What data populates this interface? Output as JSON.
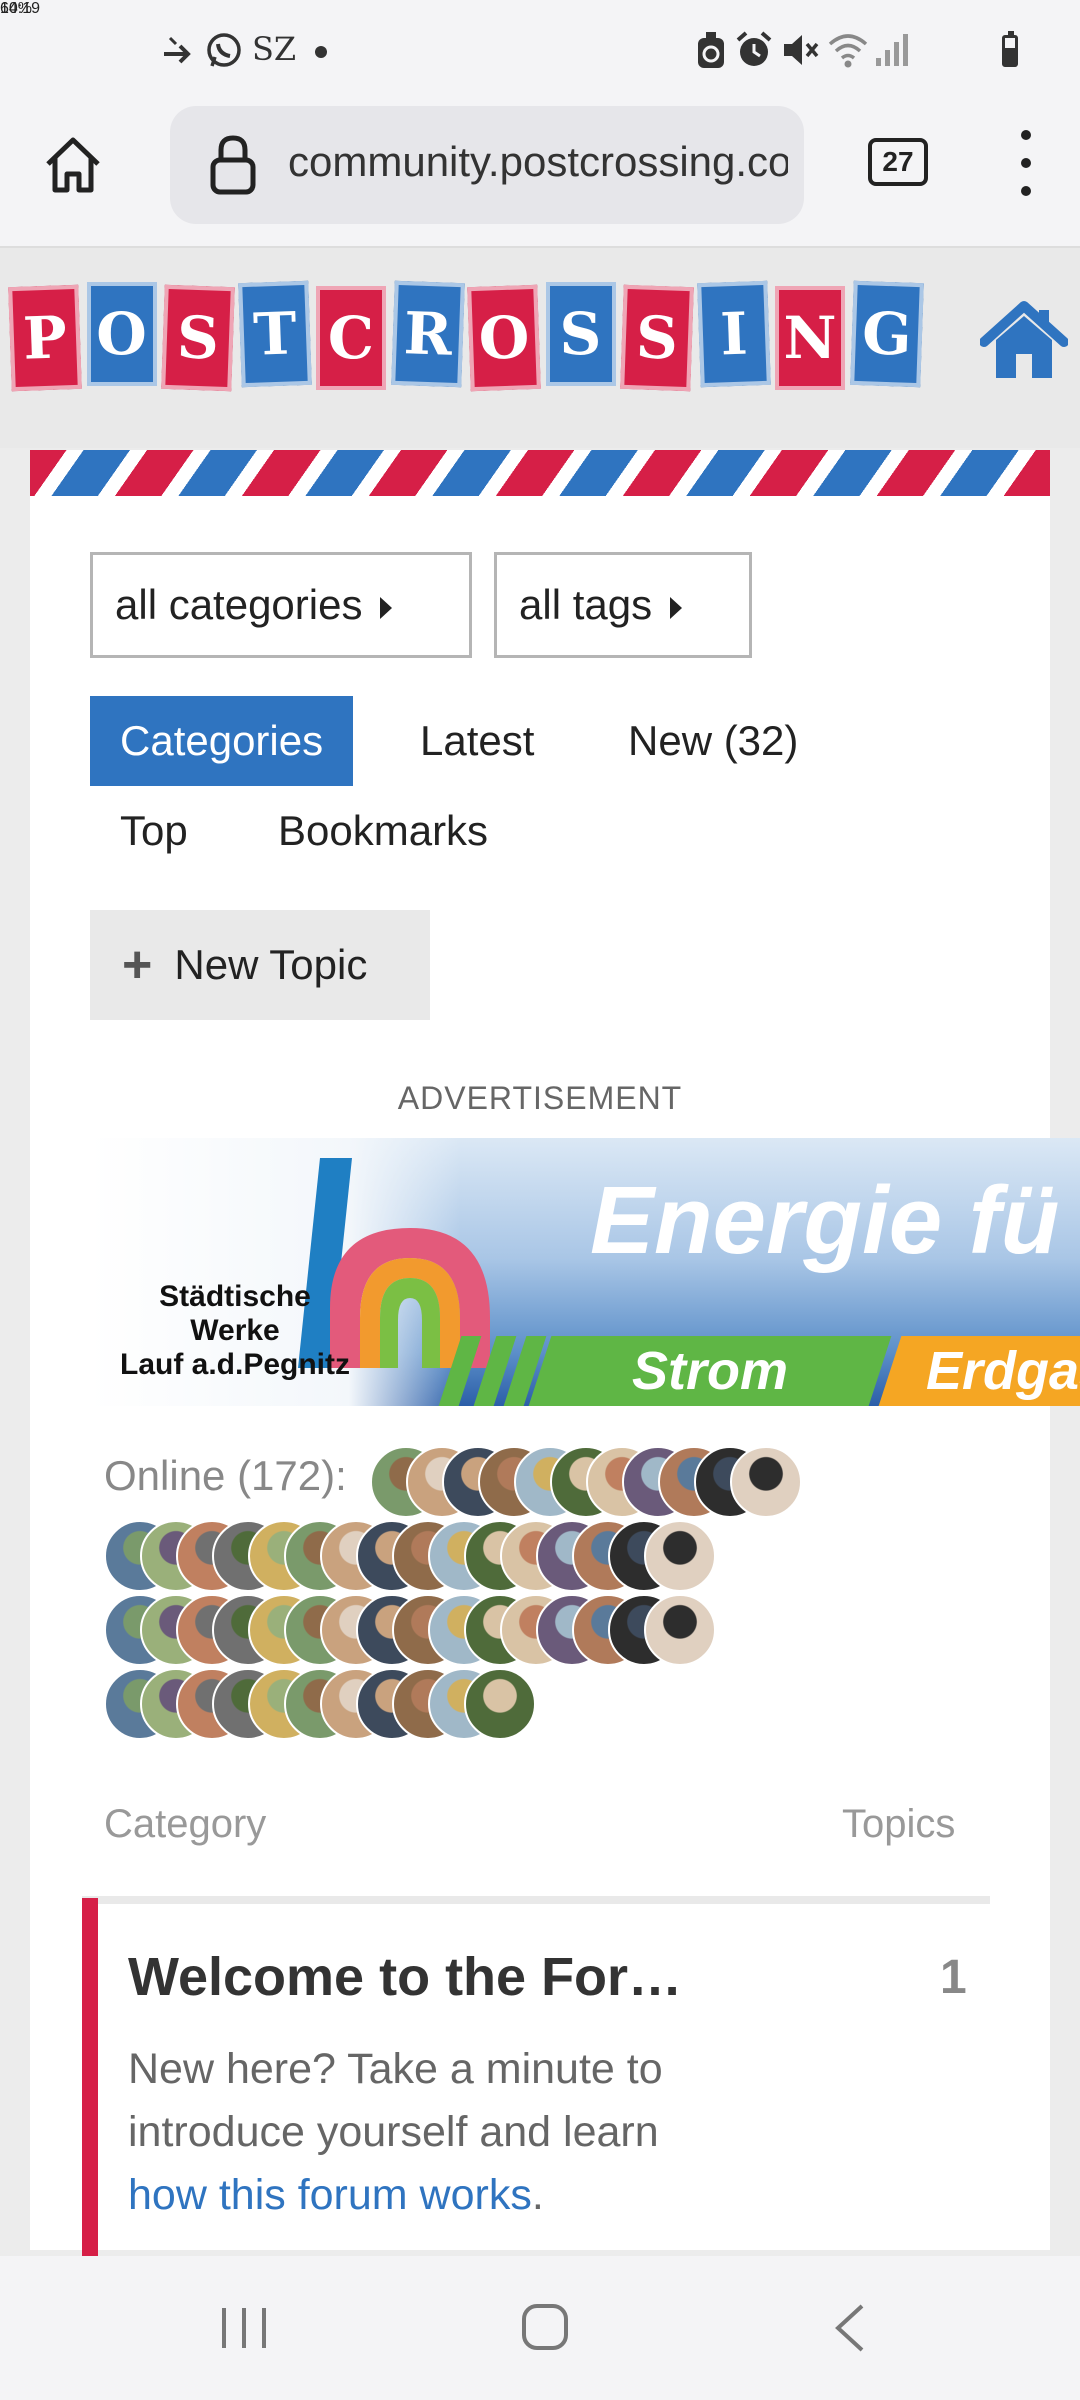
{
  "status_bar": {
    "time": "14:19",
    "left_icons": [
      "call-forward-icon",
      "whatsapp-icon",
      "sz-icon",
      "dot-icon"
    ],
    "sz_text": "SZ",
    "right_icons": [
      "recycle-icon",
      "alarm-icon",
      "mute-icon",
      "wifi-icon",
      "signal-icon"
    ],
    "battery": "60%",
    "battery_level": 0.6
  },
  "browser": {
    "url": "community.postcrossing.com",
    "tab_count": "27"
  },
  "logo": {
    "letters": [
      "P",
      "O",
      "S",
      "T",
      "C",
      "R",
      "O",
      "S",
      "S",
      "I",
      "N",
      "G"
    ]
  },
  "filters": {
    "categories_dropdown": "all categories",
    "tags_dropdown": "all tags"
  },
  "nav": {
    "categories": "Categories",
    "latest": "Latest",
    "new": "New (32)",
    "top": "Top",
    "bookmarks": "Bookmarks"
  },
  "new_topic": "New Topic",
  "advertisement": {
    "label": "ADVERTISEMENT",
    "brand_line1": "Städtische",
    "brand_line2": "Werke",
    "brand_line3": "Lauf a.d.Pegnitz",
    "headline": "Energie fü",
    "tag1": "Strom",
    "tag2": "Erdgas"
  },
  "online": {
    "label": "Online (172):"
  },
  "table": {
    "category_header": "Category",
    "topics_header": "Topics",
    "rows": [
      {
        "title": "Welcome to the For…",
        "count": "1",
        "desc_prefix": "New here? Take a minute to introduce yourself and learn ",
        "desc_link": "how this forum works",
        "desc_suffix": "."
      }
    ]
  },
  "colors": {
    "red": "#d61f47",
    "blue": "#2f74c0"
  }
}
